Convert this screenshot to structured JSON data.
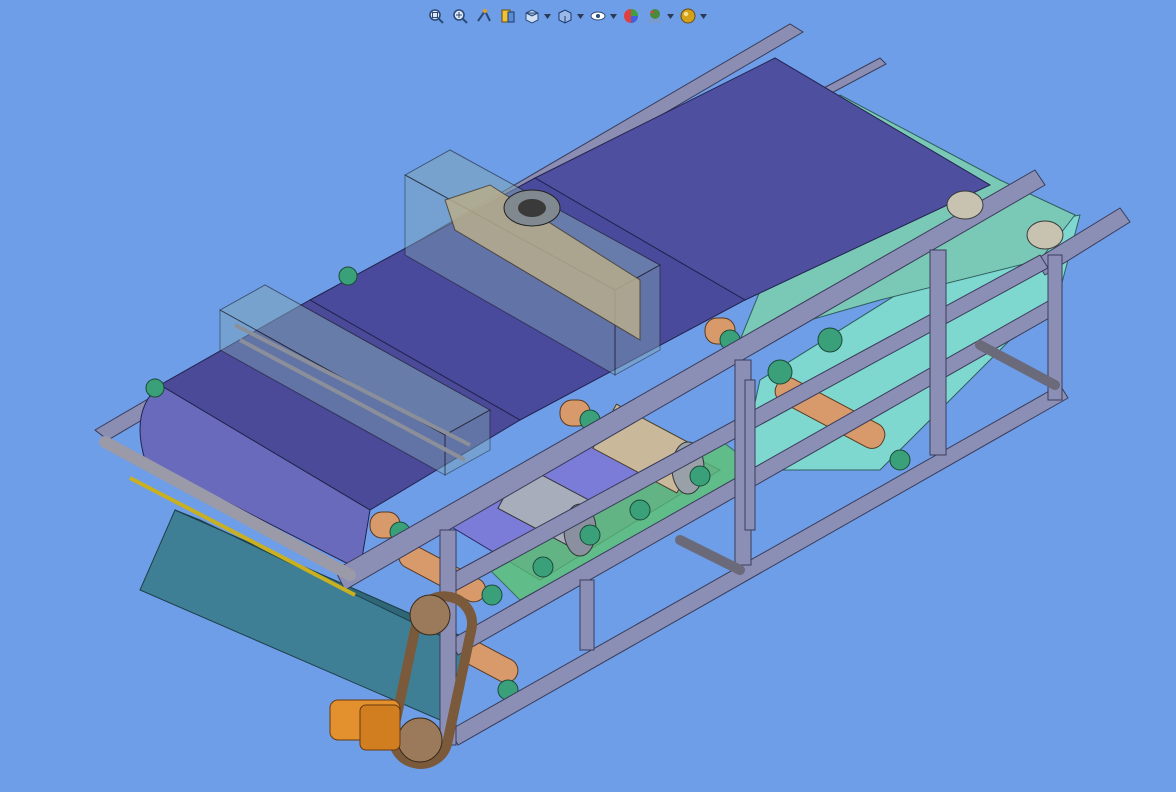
{
  "viewport": {
    "background": "#6e9ee8"
  },
  "toolbar": {
    "items": [
      {
        "name": "zoom-to-fit-icon",
        "dropdown": false
      },
      {
        "name": "zoom-to-area-icon",
        "dropdown": false
      },
      {
        "name": "previous-view-icon",
        "dropdown": false
      },
      {
        "name": "section-view-icon",
        "dropdown": false
      },
      {
        "name": "view-orientation-icon",
        "dropdown": true
      },
      {
        "name": "display-style-icon",
        "dropdown": true
      },
      {
        "name": "hide-show-items-icon",
        "dropdown": true
      },
      {
        "name": "edit-appearance-icon",
        "dropdown": false
      },
      {
        "name": "apply-scene-icon",
        "dropdown": true
      },
      {
        "name": "view-settings-icon",
        "dropdown": true
      }
    ]
  },
  "model": {
    "description_colors": {
      "belt": "#4f4fa0",
      "frame": "#8c8fb5",
      "cloth": "#7fd4cc",
      "roller": "#d89a6a",
      "bearing": "#3aa07a",
      "hopper": "#3e7f95",
      "motor": "#e3902e"
    }
  }
}
